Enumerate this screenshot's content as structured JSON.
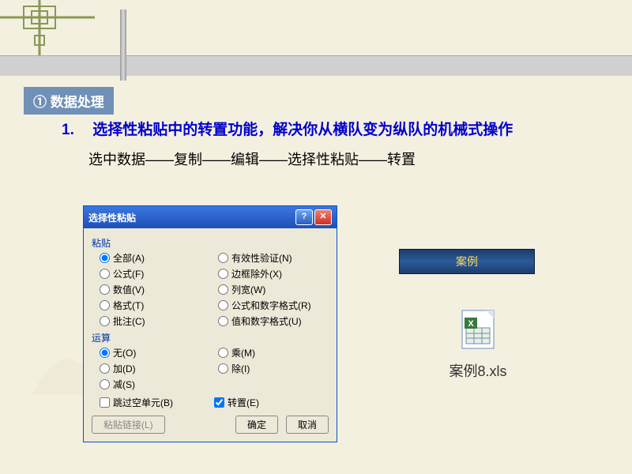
{
  "section_header": "① 数据处理",
  "item": {
    "number": "1.",
    "text": "选择性粘贴中的转置功能，解决你从横队变为纵队的机械式操作"
  },
  "steps": "选中数据——复制——编辑——选择性粘贴——转置",
  "dialog": {
    "title": "选择性粘贴",
    "group_paste": "粘贴",
    "paste_options": [
      {
        "label": "全部(A)",
        "checked": true
      },
      {
        "label": "有效性验证(N)",
        "checked": false
      },
      {
        "label": "公式(F)",
        "checked": false
      },
      {
        "label": "边框除外(X)",
        "checked": false
      },
      {
        "label": "数值(V)",
        "checked": false
      },
      {
        "label": "列宽(W)",
        "checked": false
      },
      {
        "label": "格式(T)",
        "checked": false
      },
      {
        "label": "公式和数字格式(R)",
        "checked": false
      },
      {
        "label": "批注(C)",
        "checked": false
      },
      {
        "label": "值和数字格式(U)",
        "checked": false
      }
    ],
    "group_operation": "运算",
    "operation_options": [
      {
        "label": "无(O)",
        "checked": true
      },
      {
        "label": "乘(M)",
        "checked": false
      },
      {
        "label": "加(D)",
        "checked": false
      },
      {
        "label": "除(I)",
        "checked": false
      },
      {
        "label": "减(S)",
        "checked": false
      }
    ],
    "skip_blanks": {
      "label": "跳过空单元(B)",
      "checked": false
    },
    "transpose": {
      "label": "转置(E)",
      "checked": true
    },
    "paste_link": "粘贴链接(L)",
    "ok": "确定",
    "cancel": "取消"
  },
  "example_label": "案例",
  "file": {
    "name": "案例8.xls"
  }
}
